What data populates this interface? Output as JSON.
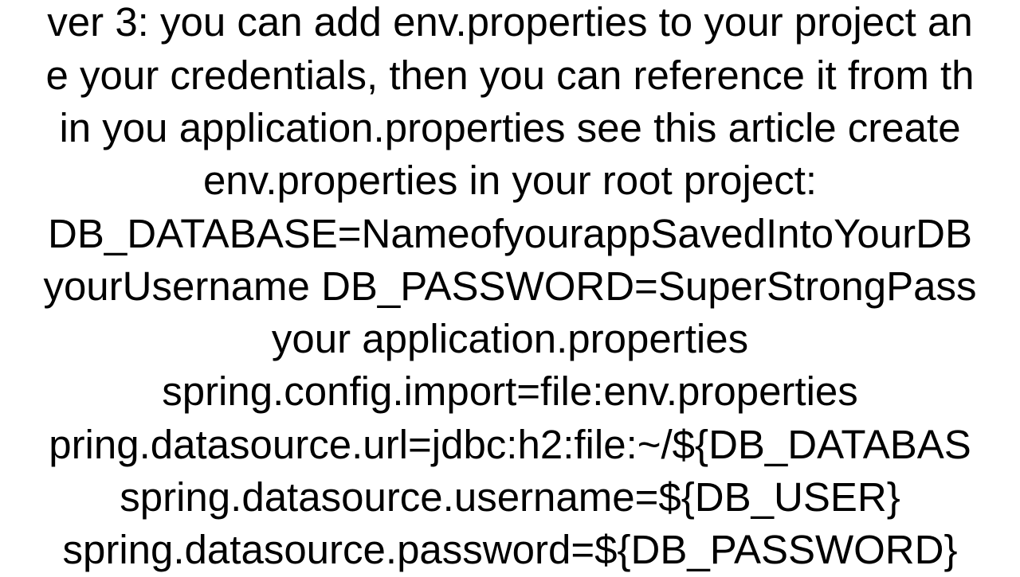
{
  "doc": {
    "lines": [
      "ver 3: you can add env.properties to your project an",
      "e your credentials, then you can reference it from th",
      "in you application.properties see this article create",
      "env.properties in your root project:",
      "DB_DATABASE=NameofyourappSavedIntoYourDB",
      "yourUsername DB_PASSWORD=SuperStrongPass",
      "your application.properties",
      "spring.config.import=file:env.properties",
      "pring.datasource.url=jdbc:h2:file:~/${DB_DATABAS",
      "spring.datasource.username=${DB_USER}",
      "spring.datasource.password=${DB_PASSWORD}"
    ]
  }
}
